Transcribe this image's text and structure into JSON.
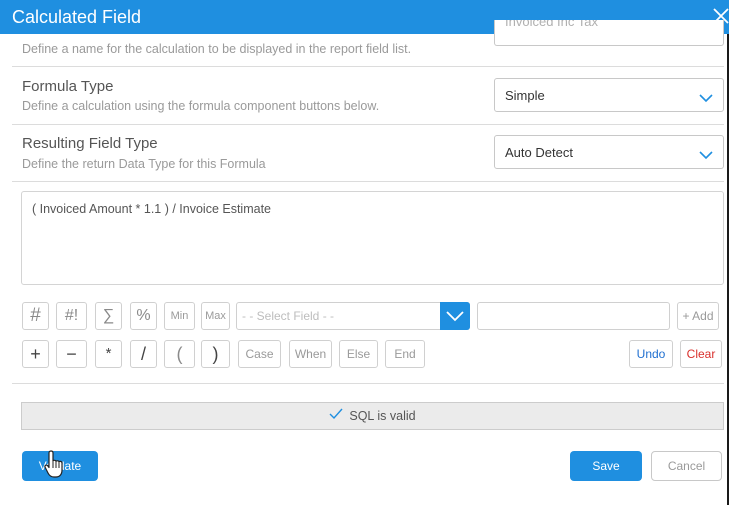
{
  "dialog": {
    "title": "Calculated Field"
  },
  "name_row": {
    "description": "Define a name for the calculation to be displayed in the report field list.",
    "value": "Invoiced Inc Tax"
  },
  "formula_type": {
    "label": "Formula Type",
    "description": "Define a calculation using the formula component buttons below.",
    "selected": "Simple"
  },
  "result_type": {
    "label": "Resulting Field Type",
    "description": "Define the return Data Type for this Formula",
    "selected": "Auto Detect"
  },
  "formula": {
    "text": "( Invoiced Amount * 1.1 ) / Invoice Estimate"
  },
  "toolbar": {
    "hash": "#",
    "hash_bang": "#!",
    "sum": "∑",
    "percent": "%",
    "min": "Min",
    "max": "Max",
    "field_placeholder": "- - Select Field - -",
    "add": "+ Add",
    "plus": "+",
    "minus": "−",
    "multiply": "*",
    "divide": "/",
    "open_paren": "(",
    "close_paren": ")",
    "case": "Case",
    "when": "When",
    "else": "Else",
    "end": "End",
    "undo": "Undo",
    "clear": "Clear"
  },
  "status": {
    "message": "SQL is valid"
  },
  "footer": {
    "validate": "Validate",
    "save": "Save",
    "cancel": "Cancel"
  },
  "colors": {
    "accent": "#1f8fe0",
    "clear": "#d9302c",
    "undo": "#1f6fd0"
  }
}
